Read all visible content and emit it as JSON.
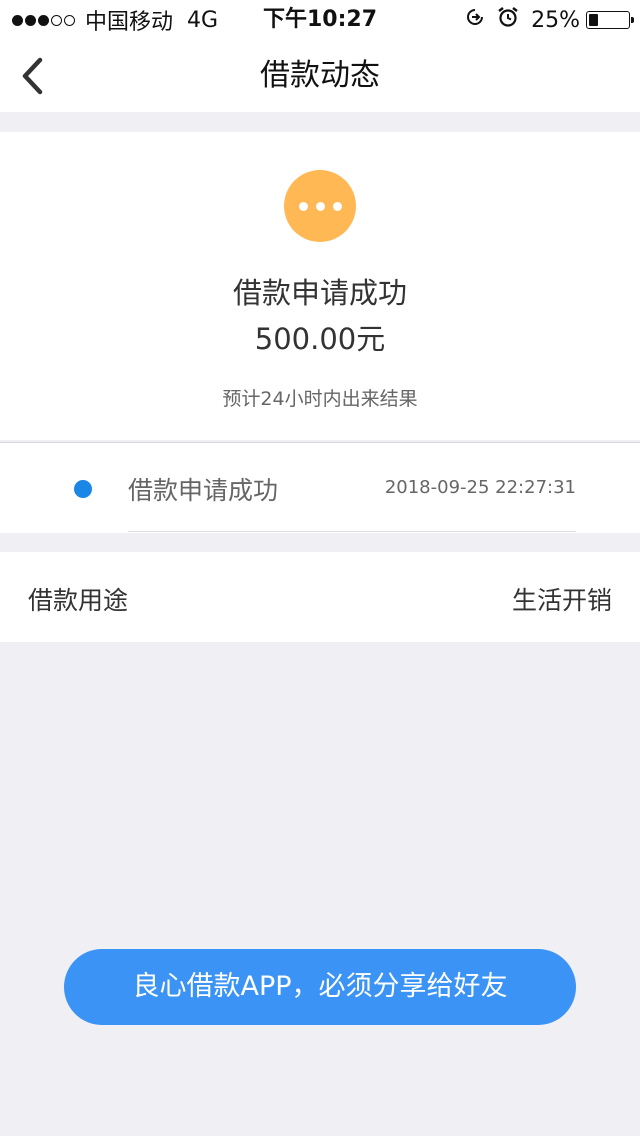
{
  "status_bar": {
    "carrier": "中国移动",
    "network": "4G",
    "time": "下午10:27",
    "battery": "25%",
    "battery_level": 0.25,
    "icons": [
      "signal-dots-icon",
      "orientation-lock-icon",
      "alarm-icon",
      "battery-icon"
    ]
  },
  "nav": {
    "title": "借款动态",
    "back_icon": "chevron-left-icon"
  },
  "status": {
    "icon": "pending-dots-icon",
    "icon_color": "#ffb854",
    "title": "借款申请成功",
    "amount": "500.00元",
    "hint": "预计24小时内出来结果"
  },
  "timeline": {
    "items": [
      {
        "label": "借款申请成功",
        "time": "2018-09-25 22:27:31",
        "dot_color": "#1a86e6"
      }
    ]
  },
  "purpose": {
    "label": "借款用途",
    "value": "生活开销"
  },
  "share": {
    "label": "良心借款APP，必须分享给好友",
    "color": "#3a93f5"
  }
}
